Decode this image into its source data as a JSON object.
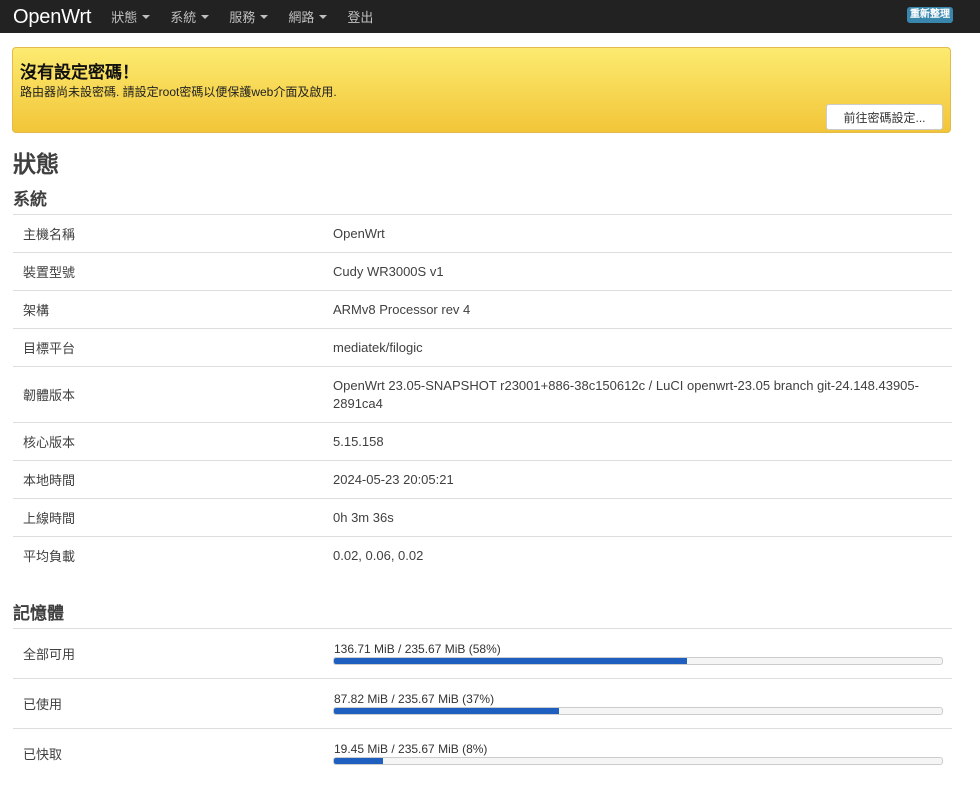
{
  "navbar": {
    "brand": "OpenWrt",
    "menu": [
      {
        "label": "狀態",
        "has_caret": true
      },
      {
        "label": "系統",
        "has_caret": true
      },
      {
        "label": "服務",
        "has_caret": true
      },
      {
        "label": "網路",
        "has_caret": true
      },
      {
        "label": "登出",
        "has_caret": false
      }
    ],
    "refresh_label": "重新整理"
  },
  "alert": {
    "title": "沒有設定密碼！",
    "text": "路由器尚未設密碼. 請設定root密碼以便保護web介面及啟用.",
    "button_label": "前往密碼設定..."
  },
  "page_title": "狀態",
  "system": {
    "title": "系統",
    "rows": [
      {
        "label": "主機名稱",
        "value": "OpenWrt"
      },
      {
        "label": "裝置型號",
        "value": "Cudy WR3000S v1"
      },
      {
        "label": "架構",
        "value": "ARMv8 Processor rev 4"
      },
      {
        "label": "目標平台",
        "value": "mediatek/filogic"
      },
      {
        "label": "韌體版本",
        "value": "OpenWrt 23.05-SNAPSHOT r23001+886-38c150612c / LuCI openwrt-23.05 branch git-24.148.43905-2891ca4"
      },
      {
        "label": "核心版本",
        "value": "5.15.158"
      },
      {
        "label": "本地時間",
        "value": "2024-05-23 20:05:21"
      },
      {
        "label": "上線時間",
        "value": "0h 3m 36s"
      },
      {
        "label": "平均負載",
        "value": "0.02, 0.06, 0.02"
      }
    ]
  },
  "memory": {
    "title": "記憶體",
    "rows": [
      {
        "label": "全部可用",
        "text": "136.71 MiB / 235.67 MiB (58%)",
        "fraction": 0.58
      },
      {
        "label": "已使用",
        "text": "87.82 MiB / 235.67 MiB (37%)",
        "fraction": 0.37
      },
      {
        "label": "已快取",
        "text": "19.45 MiB / 235.67 MiB (8%)",
        "fraction": 0.08
      }
    ],
    "bar_color": "#1e5fbf"
  },
  "colors": {
    "navbar_bg": "#222222",
    "alert_bg": "#f2c538",
    "refresh_badge": "#3a87ad"
  }
}
